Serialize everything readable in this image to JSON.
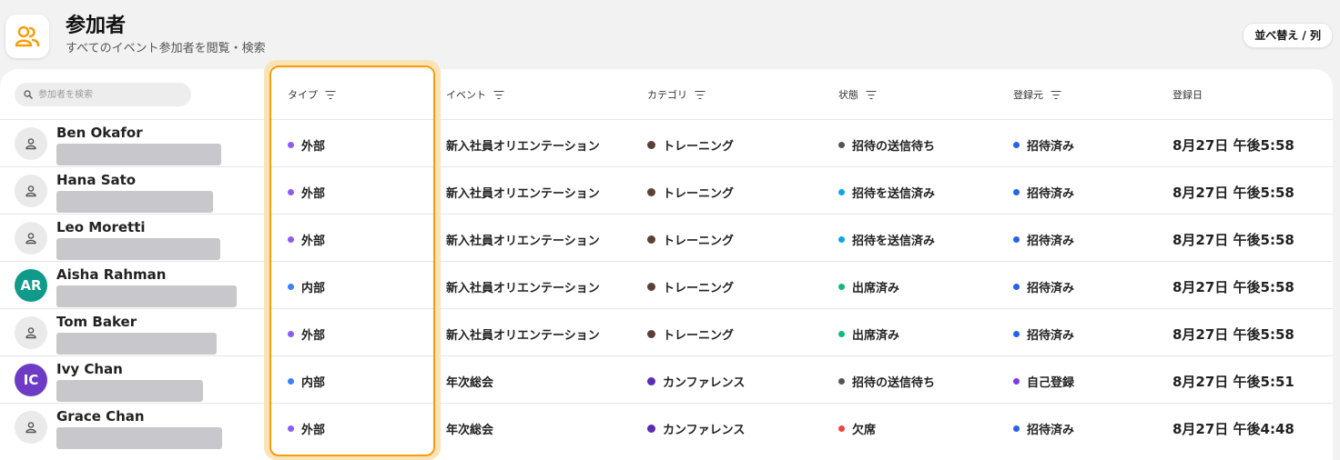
{
  "header": {
    "title": "参加者",
    "subtitle": "すべてのイベント参加者を閲覧・検索",
    "sort_button": "並べ替え / 列",
    "icon": "users-icon",
    "accent": "#f59e0b"
  },
  "search": {
    "placeholder": "参加者を検索"
  },
  "columns": {
    "type": "タイプ",
    "event": "イベント",
    "category": "カテゴリ",
    "status": "状態",
    "source": "登録元",
    "date": "登録日"
  },
  "colors": {
    "external": "#8b5cf6",
    "internal": "#3b82f6",
    "training": "#5b4038",
    "conference": "#5b2bb5",
    "pending": "#555555",
    "sent": "#0ea5e9",
    "attended": "#10b981",
    "absent": "#ef4444",
    "invited": "#2563eb",
    "self": "#7c3aed",
    "avatar_ar": "#0f9a8a",
    "avatar_ic": "#6d3bc4"
  },
  "rows": [
    {
      "name": "Ben Okafor",
      "avatar": "person-icon",
      "type": "外部",
      "event": "新入社員オリエンテーション",
      "category": "トレーニング",
      "status": "招待の送信待ち",
      "source": "招待済み",
      "date": "8月27日 午後5:58"
    },
    {
      "name": "Hana Sato",
      "avatar": "person-icon",
      "type": "外部",
      "event": "新入社員オリエンテーション",
      "category": "トレーニング",
      "status": "招待を送信済み",
      "source": "招待済み",
      "date": "8月27日 午後5:58"
    },
    {
      "name": "Leo Moretti",
      "avatar": "person-icon",
      "type": "外部",
      "event": "新入社員オリエンテーション",
      "category": "トレーニング",
      "status": "招待を送信済み",
      "source": "招待済み",
      "date": "8月27日 午後5:58"
    },
    {
      "name": "Aisha Rahman",
      "avatar": "AR",
      "type": "内部",
      "event": "新入社員オリエンテーション",
      "category": "トレーニング",
      "status": "出席済み",
      "source": "招待済み",
      "date": "8月27日 午後5:58"
    },
    {
      "name": "Tom Baker",
      "avatar": "person-icon",
      "type": "外部",
      "event": "新入社員オリエンテーション",
      "category": "トレーニング",
      "status": "出席済み",
      "source": "招待済み",
      "date": "8月27日 午後5:58"
    },
    {
      "name": "Ivy Chan",
      "avatar": "IC",
      "type": "内部",
      "event": "年次総会",
      "category": "カンファレンス",
      "status": "招待の送信待ち",
      "source": "自己登録",
      "date": "8月27日 午後5:51"
    },
    {
      "name": "Grace Chan",
      "avatar": "person-icon",
      "type": "外部",
      "event": "年次総会",
      "category": "カンファレンス",
      "status": "欠席",
      "source": "招待済み",
      "date": "8月27日 午後4:48"
    }
  ]
}
